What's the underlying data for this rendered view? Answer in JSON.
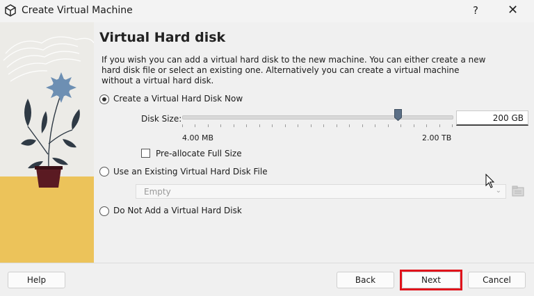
{
  "window": {
    "title": "Create Virtual Machine",
    "help_label": "?",
    "close_label": "✕"
  },
  "page": {
    "heading": "Virtual Hard disk",
    "description": "If you wish you can add a virtual hard disk to the new machine. You can either create a new hard disk file or select an existing one. Alternatively you can create a virtual machine without a virtual hard disk."
  },
  "options": {
    "create_now": {
      "label": "Create a Virtual Hard Disk Now",
      "selected": true
    },
    "use_existing": {
      "label": "Use an Existing Virtual Hard Disk File",
      "selected": false
    },
    "none": {
      "label": "Do Not Add a Virtual Hard Disk",
      "selected": false
    }
  },
  "disk_size": {
    "label": "Disk Size:",
    "value": "200 GB",
    "min_label": "4.00 MB",
    "max_label": "2.00 TB",
    "slider_fraction": 0.8
  },
  "preallocate": {
    "label": "Pre-allocate Full Size",
    "checked": false
  },
  "existing_file": {
    "selected": "Empty"
  },
  "buttons": {
    "help": "Help",
    "back": "Back",
    "next": "Next",
    "cancel": "Cancel"
  },
  "icons": {
    "app": "virtualbox-cube-icon",
    "folder": "folder-open-icon",
    "cursor": "mouse-pointer-icon"
  },
  "colors": {
    "highlight": "#e0121b",
    "art_yellow": "#ecc35a",
    "plant_pot": "#5a1a22"
  }
}
